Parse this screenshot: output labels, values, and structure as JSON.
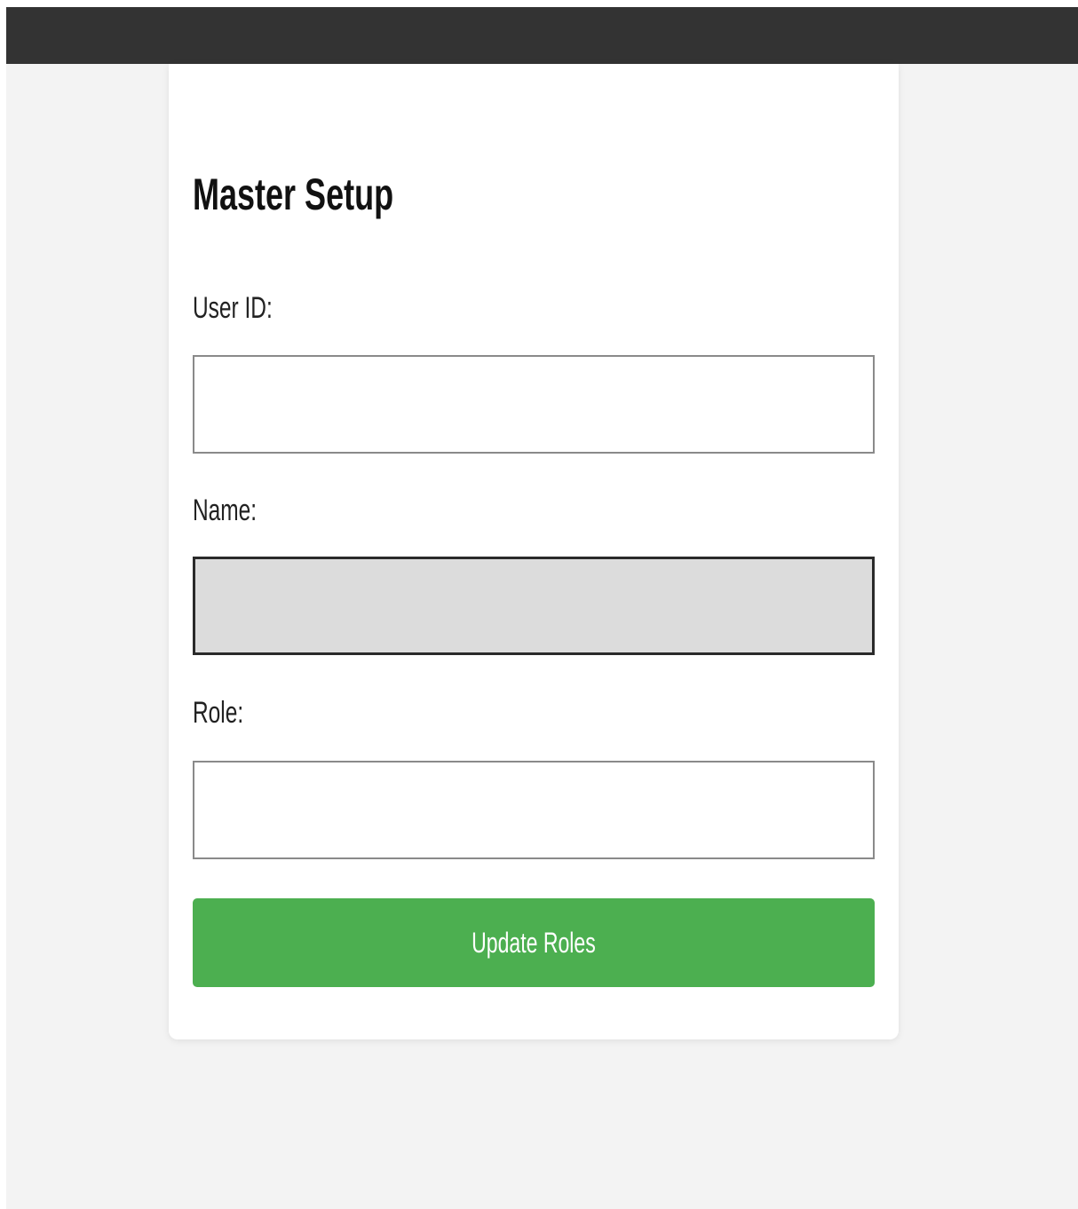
{
  "form": {
    "title": "Master Setup",
    "user_id_label": "User ID:",
    "user_id_value": "",
    "name_label": "Name:",
    "name_value": "",
    "role_label": "Role:",
    "role_value": "",
    "submit_label": "Update Roles"
  },
  "colors": {
    "topbar": "#333333",
    "page_background": "#f3f3f3",
    "card_background": "#ffffff",
    "button": "#4caf50",
    "readonly_field": "#dcdcdc"
  }
}
